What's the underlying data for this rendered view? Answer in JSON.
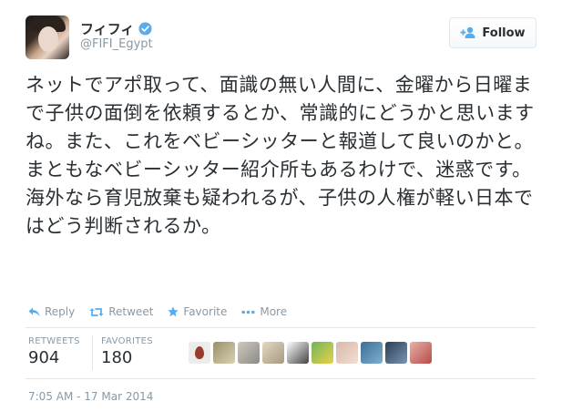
{
  "user": {
    "display_name": "フィフィ",
    "handle": "@FIFI_Egypt",
    "verified": true
  },
  "follow_button": {
    "label": "Follow",
    "icon": "user-plus-icon"
  },
  "tweet": {
    "text": "ネットでアポ取って、面識の無い人間に、金曜から日曜まで子供の面倒を依頼するとか、常識的にどうかと思いますね。また、これをベビーシッターと報道して良いのかと。まともなベビーシッター紹介所もあるわけで、迷惑です。海外なら育児放棄も疑われるが、子供の人権が軽い日本ではどう判断されるか。"
  },
  "actions": [
    {
      "label": "Reply",
      "icon": "reply-icon"
    },
    {
      "label": "Retweet",
      "icon": "retweet-icon"
    },
    {
      "label": "Favorite",
      "icon": "star-icon"
    },
    {
      "label": "More",
      "icon": "more-dots-icon"
    }
  ],
  "stats": {
    "retweets_label": "RETWEETS",
    "retweets_value": "904",
    "favorites_label": "FAVORITES",
    "favorites_value": "180"
  },
  "favoriters": [
    {
      "name": "default-egg-avatar",
      "colors": [
        "#e7e7e7",
        "#c3a9a0"
      ]
    },
    {
      "name": "avatar-2",
      "colors": [
        "#9b8f68",
        "#d8d2b5"
      ]
    },
    {
      "name": "avatar-3",
      "colors": [
        "#cfc8bd",
        "#8c8a86"
      ]
    },
    {
      "name": "avatar-4",
      "colors": [
        "#e2d9c4",
        "#a89880"
      ]
    },
    {
      "name": "avatar-5",
      "colors": [
        "#ffffff",
        "#444444"
      ]
    },
    {
      "name": "avatar-6",
      "colors": [
        "#6fb55b",
        "#e9d148"
      ]
    },
    {
      "name": "avatar-7",
      "colors": [
        "#d9b9a8",
        "#f2ddd2"
      ]
    },
    {
      "name": "avatar-8",
      "colors": [
        "#3b6f96",
        "#7fb0d0"
      ]
    },
    {
      "name": "avatar-9",
      "colors": [
        "#2c3e55",
        "#7a95b3"
      ]
    },
    {
      "name": "avatar-10",
      "colors": [
        "#e5b1a6",
        "#b94a4a"
      ]
    }
  ],
  "timestamp": "7:05 AM - 17 Mar 2014",
  "colors": {
    "accent": "#55acee",
    "secondary_text": "#8899a6",
    "primary_text": "#292f33",
    "border": "#e1e8ed"
  }
}
